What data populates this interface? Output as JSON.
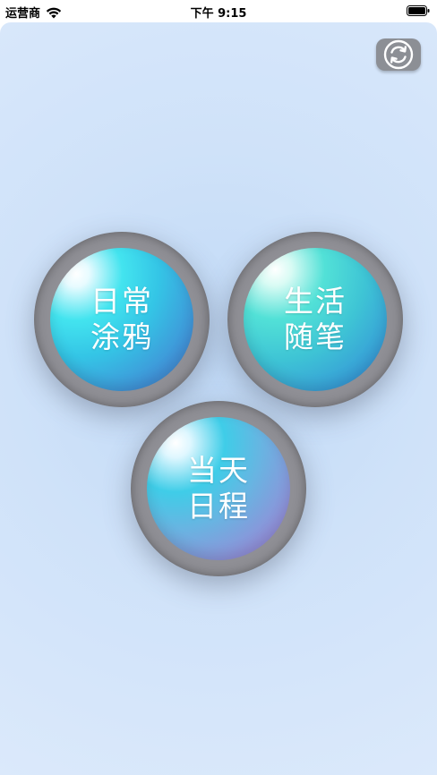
{
  "status_bar": {
    "carrier": "运营商",
    "time": "下午 9:15"
  },
  "toolbar": {
    "refresh_icon": "refresh-icon"
  },
  "buttons": [
    {
      "label": "日常涂鸦"
    },
    {
      "label": "生活随笔"
    },
    {
      "label": "当天日程"
    }
  ],
  "colors": {
    "background": "#cfe2f9",
    "ring": "#8f8f95",
    "refresh_button": "#8c8f95"
  }
}
